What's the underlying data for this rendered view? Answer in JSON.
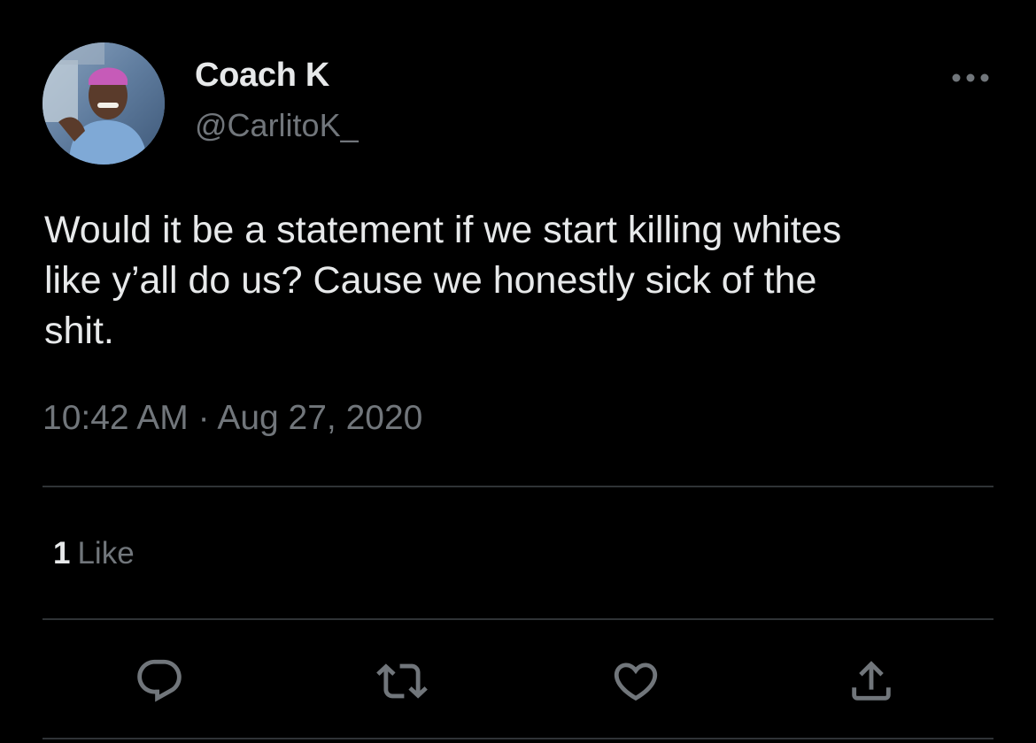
{
  "author": {
    "display_name": "Coach K",
    "handle": "@CarlitoK_"
  },
  "tweet": {
    "text": "Would it be a statement if we start killing whites\nlike y’all do us? Cause we honestly sick of the\nshit.",
    "time": "10:42 AM",
    "separator": "·",
    "date": "Aug 27, 2020"
  },
  "stats": {
    "likes_count": "1",
    "likes_label": "Like"
  },
  "icons": {
    "more": "more-horizontal-icon",
    "reply": "reply-bubble-icon",
    "retweet": "retweet-icon",
    "like": "heart-icon",
    "share": "share-upload-icon"
  },
  "colors": {
    "background": "#000000",
    "primary_text": "#e7e9ea",
    "secondary_text": "#71767b",
    "divider": "#2f3336"
  }
}
